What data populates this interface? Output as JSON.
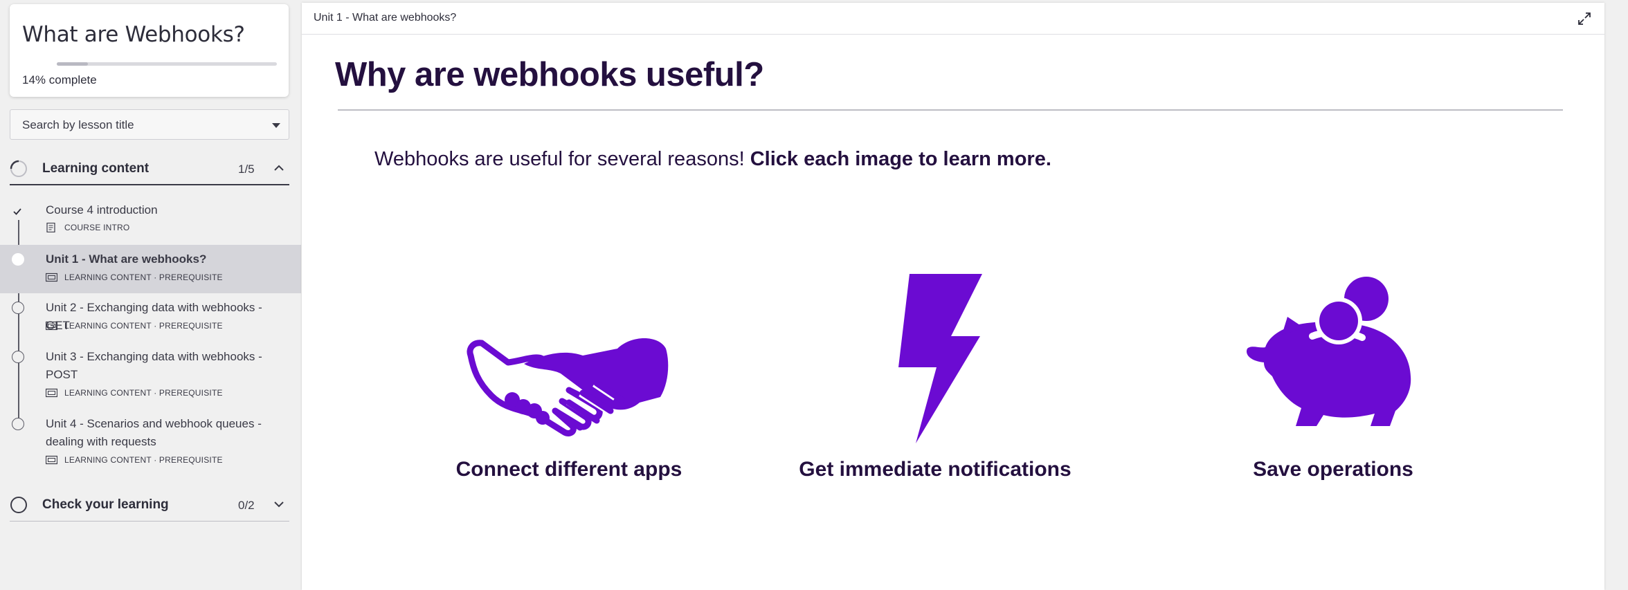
{
  "sidebar": {
    "course_title": "What are Webhooks?",
    "progress_percent": 14,
    "progress_pct_text": "14%",
    "progress_suffix": " complete",
    "search_placeholder": "Search by lesson title",
    "sections": [
      {
        "label": "Learning content",
        "count": "1/5",
        "expanded": true,
        "lessons": [
          {
            "title": "Course 4 introduction",
            "meta": "COURSE INTRO",
            "state": "completed"
          },
          {
            "title": "Unit 1 - What are webhooks?",
            "meta": "LEARNING CONTENT · PREREQUISITE",
            "state": "current"
          },
          {
            "title": "Unit 2 - Exchanging data with webhooks - GET",
            "meta": "LEARNING CONTENT · PREREQUISITE",
            "state": "not-started"
          },
          {
            "title": "Unit 3 - Exchanging data with webhooks - POST",
            "meta": "LEARNING CONTENT · PREREQUISITE",
            "state": "not-started"
          },
          {
            "title": "Unit 4 - Scenarios and webhook queues - dealing with requests",
            "meta": "LEARNING CONTENT · PREREQUISITE",
            "state": "not-started"
          }
        ]
      },
      {
        "label": "Check your learning",
        "count": "0/2",
        "expanded": false
      }
    ]
  },
  "main": {
    "breadcrumb": "Unit 1 - What are webhooks?",
    "page_title": "Why are webhooks useful?",
    "intro_text": "Webhooks are useful for several reasons! ",
    "intro_bold": "Click each image to learn more.",
    "cards": [
      {
        "label": "Connect different apps",
        "icon": "handshake-icon"
      },
      {
        "label": "Get immediate notifications",
        "icon": "lightning-bolt-icon"
      },
      {
        "label": "Save operations",
        "icon": "piggy-bank-icon"
      }
    ]
  },
  "colors": {
    "accent_purple": "#6b0bd2",
    "heading": "#24103f",
    "sidebar_bg": "#f0f0f0",
    "active_row": "#d5d5da"
  }
}
